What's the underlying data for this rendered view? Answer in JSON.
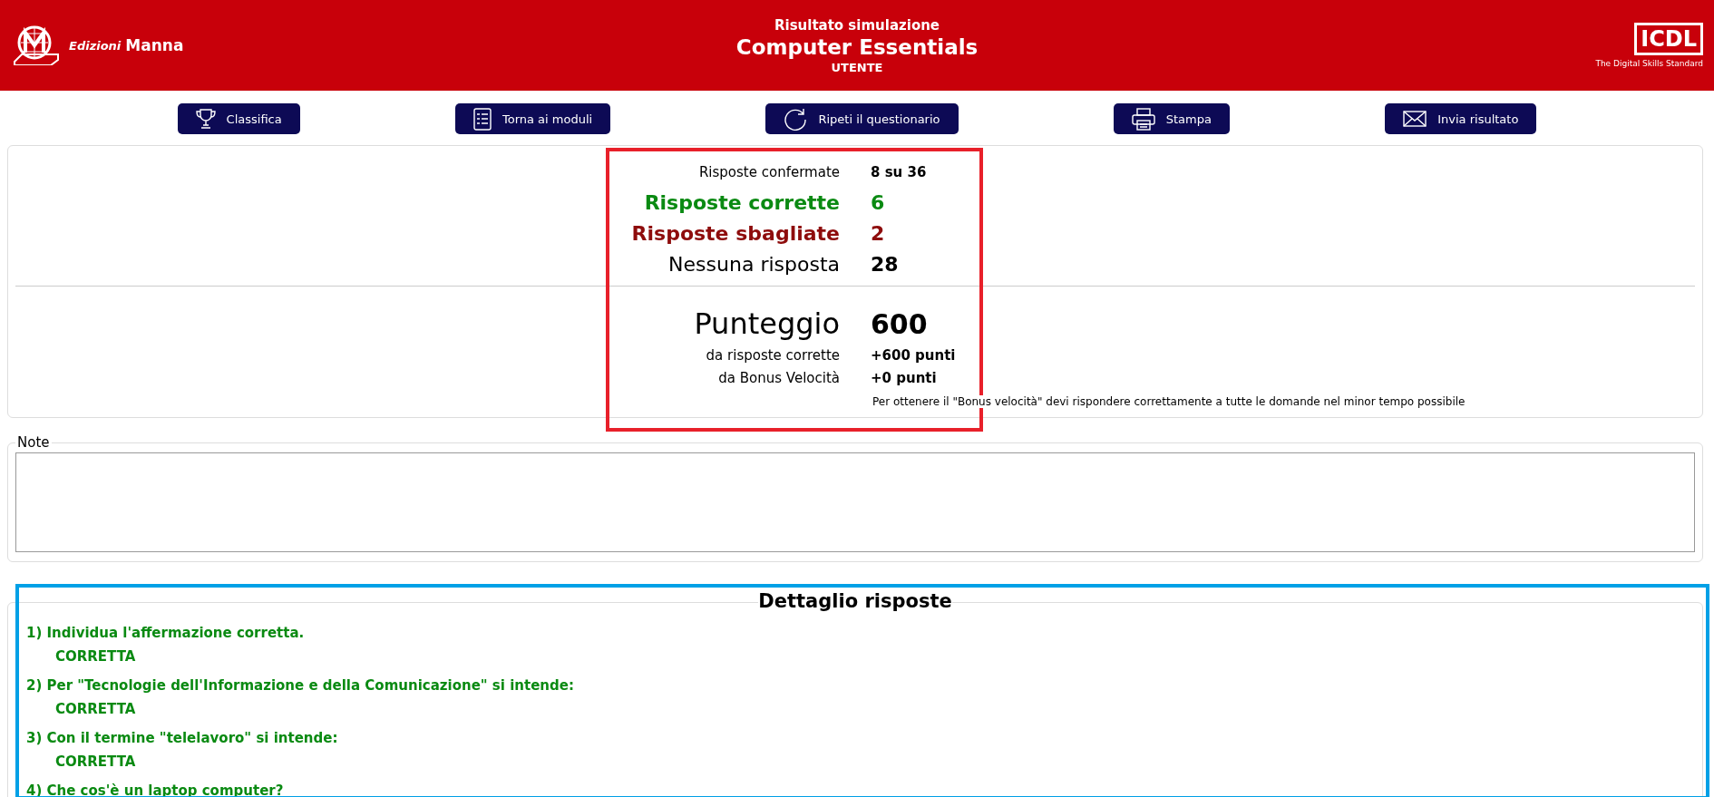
{
  "header": {
    "publisher_logo": {
      "word_1": "Edizioni",
      "word_2": "Manna"
    },
    "subtitle": "Risultato simulazione",
    "title": "Computer Essentials",
    "user": "UTENTE",
    "icdl_logo": {
      "mark": "ICDL",
      "tagline": "The Digital Skills Standard"
    }
  },
  "toolbar": [
    {
      "kind": "trophy",
      "label": "Classifica"
    },
    {
      "kind": "list",
      "label": "Torna ai moduli"
    },
    {
      "kind": "refresh",
      "label": "Ripeti il questionario"
    },
    {
      "kind": "print",
      "label": "Stampa"
    },
    {
      "kind": "mail",
      "label": "Invia risultato"
    }
  ],
  "highlight_frames": [
    {
      "color": "#e8202a"
    },
    {
      "color": "#00a0e6"
    }
  ],
  "score": {
    "counts": [
      {
        "kind": "plain",
        "label": "Risposte confermate",
        "value": "8 su 36"
      },
      {
        "kind": "correct",
        "label": "Risposte corrette",
        "value": "6"
      },
      {
        "kind": "wrong",
        "label": "Risposte sbagliate",
        "value": "2"
      },
      {
        "kind": "none",
        "label": "Nessuna risposta",
        "value": "28"
      }
    ],
    "total": {
      "label": "Punteggio",
      "value": "600"
    },
    "breakdown": [
      {
        "label": "da risposte corrette",
        "value": "+600 punti"
      },
      {
        "label": "da Bonus Velocità",
        "value": "+0 punti"
      }
    ],
    "hint": "Per ottenere il \"Bonus velocità\" devi rispondere correttamente a tutte le domande nel minor tempo possibile"
  },
  "note": {
    "legend": "Note"
  },
  "details": {
    "title": "Dettaglio risposte",
    "questions": [
      {
        "text": "1) Individua l'affermazione corretta.",
        "kind": "correct",
        "status": "CORRETTA"
      },
      {
        "text": "2) Per \"Tecnologie dell'Informazione e della Comunicazione\" si intende:",
        "kind": "correct",
        "status": "CORRETTA"
      },
      {
        "text": "3) Con il termine \"telelavoro\" si intende:",
        "kind": "correct",
        "status": "CORRETTA"
      },
      {
        "text": "4) Che cos'è un laptop computer?",
        "kind": "correct"
      }
    ]
  }
}
